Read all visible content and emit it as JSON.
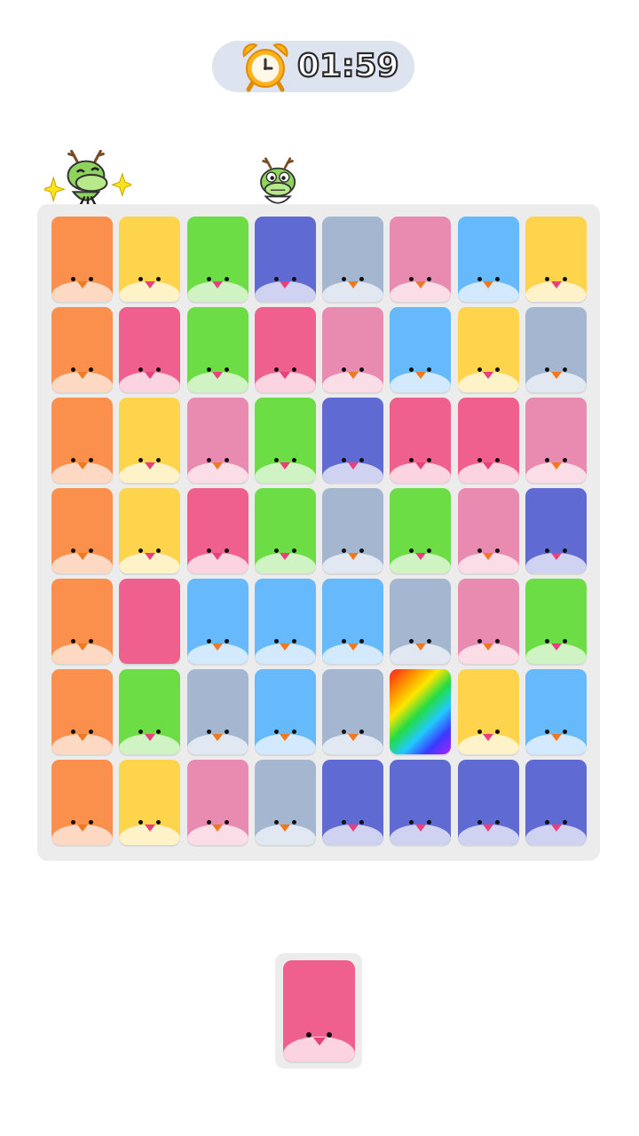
{
  "timer": {
    "time": "01:59",
    "icon": "alarm-clock-icon"
  },
  "characters": [
    {
      "name": "dragon-excited",
      "icon": "dragon-icon"
    },
    {
      "name": "dragon-nervous",
      "icon": "dragon-icon"
    }
  ],
  "palette": {
    "O": {
      "body": "#fb8f4c",
      "belly": "#fdd9c3",
      "beak": "orange"
    },
    "Y": {
      "body": "#fdd44c",
      "belly": "#fef2c8",
      "beak": "pink"
    },
    "G": {
      "body": "#6ddd46",
      "belly": "#cff3c2",
      "beak": "pink"
    },
    "I": {
      "body": "#5f6ad2",
      "belly": "#cfd2f1",
      "beak": "pink"
    },
    "S": {
      "body": "#a5b6d1",
      "belly": "#e2e8f1",
      "beak": "orange"
    },
    "L": {
      "body": "#e98bb1",
      "belly": "#fbdde8",
      "beak": "orange"
    },
    "B": {
      "body": "#66b9fb",
      "belly": "#d2e9fe",
      "beak": "orange"
    },
    "P": {
      "body": "#f0608e",
      "belly": "#fcd4e1",
      "beak": "pink"
    },
    "R": {
      "body": "rainbow",
      "belly": "",
      "beak": ""
    }
  },
  "board": {
    "rows": [
      [
        "O",
        "Y",
        "G",
        "I",
        "S",
        "L",
        "B",
        "Y"
      ],
      [
        "O",
        "P",
        "G",
        "P",
        "L",
        "B",
        "Y",
        "S"
      ],
      [
        "O",
        "Y",
        "L",
        "G",
        "I",
        "P",
        "P",
        "L"
      ],
      [
        "O",
        "Y",
        "P",
        "G",
        "S",
        "G",
        "L",
        "I"
      ],
      [
        "O",
        "P",
        "B",
        "B",
        "B",
        "S",
        "L",
        "G"
      ],
      [
        "O",
        "G",
        "S",
        "B",
        "S",
        "R",
        "Y",
        "B"
      ],
      [
        "O",
        "Y",
        "L",
        "S",
        "I",
        "I",
        "I",
        "I"
      ]
    ],
    "hidden_faces": [
      [
        4,
        1
      ],
      [
        5,
        5
      ]
    ]
  },
  "slot": {
    "cards": [
      "P"
    ]
  }
}
